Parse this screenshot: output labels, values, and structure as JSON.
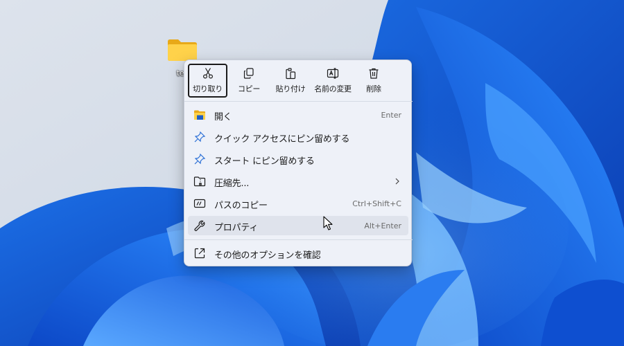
{
  "desktop": {
    "icon_label": "tes"
  },
  "context_menu": {
    "toolbar": [
      {
        "label": "切り取り",
        "icon": "scissors-icon"
      },
      {
        "label": "コピー",
        "icon": "copy-icon"
      },
      {
        "label": "貼り付け",
        "icon": "paste-icon"
      },
      {
        "label": "名前の変更",
        "icon": "rename-icon"
      },
      {
        "label": "削除",
        "icon": "trash-icon"
      }
    ],
    "items": [
      {
        "label": "開く",
        "shortcut": "Enter",
        "icon": "folder-open-icon"
      },
      {
        "label": "クイック アクセスにピン留めする",
        "icon": "pin-icon"
      },
      {
        "label": "スタート にピン留めする",
        "icon": "pin-icon"
      },
      {
        "label": "圧縮先...",
        "icon": "zip-folder-icon",
        "has_submenu": true
      },
      {
        "label": "パスのコピー",
        "shortcut": "Ctrl+Shift+C",
        "icon": "path-copy-icon"
      },
      {
        "label": "プロパティ",
        "shortcut": "Alt+Enter",
        "icon": "wrench-icon"
      },
      {
        "label": "その他のオプションを確認",
        "icon": "external-icon"
      }
    ]
  },
  "colors": {
    "accent": "#0f6cbd",
    "wallpaper_blue": "#1a73e8",
    "menu_background": "#eef1f8"
  }
}
